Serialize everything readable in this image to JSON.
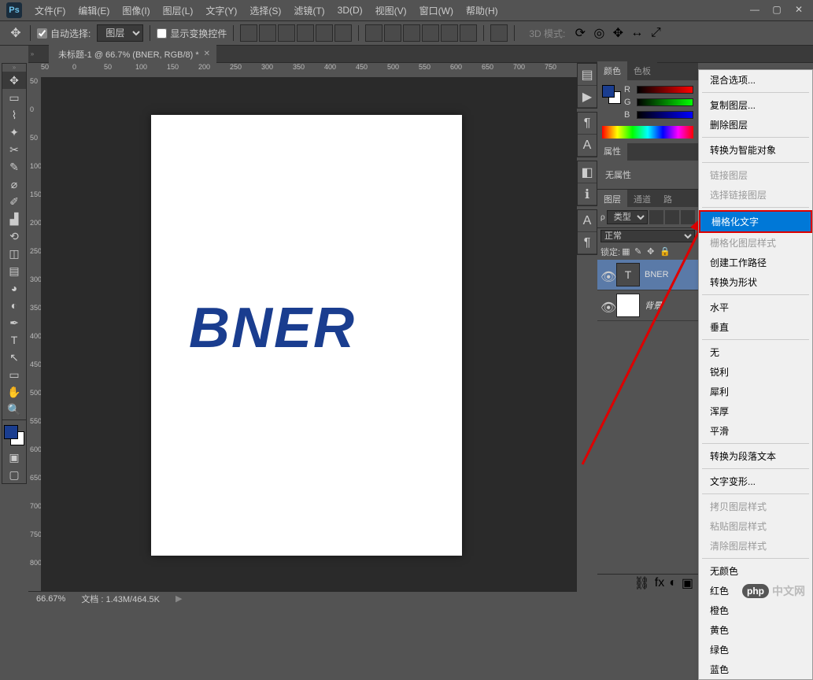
{
  "app": {
    "logo": "Ps"
  },
  "menu": [
    "文件(F)",
    "编辑(E)",
    "图像(I)",
    "图层(L)",
    "文字(Y)",
    "选择(S)",
    "滤镜(T)",
    "3D(D)",
    "视图(V)",
    "窗口(W)",
    "帮助(H)"
  ],
  "options": {
    "auto_select": "自动选择:",
    "layer_select": "图层",
    "show_transform": "显示变换控件",
    "mode_3d": "3D 模式:"
  },
  "tab": {
    "title": "未标题-1 @ 66.7% (BNER, RGB/8) *"
  },
  "ruler_h": [
    "50",
    "0",
    "50",
    "100",
    "150",
    "200",
    "250",
    "300",
    "350",
    "400",
    "450",
    "500",
    "550",
    "600",
    "650",
    "700",
    "750"
  ],
  "ruler_v": [
    "50",
    "0",
    "50",
    "100",
    "150",
    "200",
    "250",
    "300",
    "350",
    "400",
    "450",
    "500",
    "550",
    "600",
    "650",
    "700",
    "750",
    "800"
  ],
  "canvas": {
    "text": "BNER"
  },
  "panels": {
    "color_tab": "颜色",
    "swatches_tab": "色板",
    "r": "R",
    "g": "G",
    "b": "B",
    "props_tab": "属性",
    "no_props": "无属性",
    "layers_tab": "图层",
    "channels_tab": "通道",
    "paths_tab": "路",
    "kind": "类型",
    "blend": "正常",
    "lock_label": "锁定:",
    "layer_text_name": "BNER",
    "layer_bg_name": "背景",
    "thumb_t": "T"
  },
  "context_menu": {
    "items": [
      {
        "label": "混合选项...",
        "type": "item"
      },
      {
        "type": "sep"
      },
      {
        "label": "复制图层...",
        "type": "item"
      },
      {
        "label": "删除图层",
        "type": "item"
      },
      {
        "type": "sep"
      },
      {
        "label": "转换为智能对象",
        "type": "item"
      },
      {
        "type": "sep"
      },
      {
        "label": "链接图层",
        "type": "disabled"
      },
      {
        "label": "选择链接图层",
        "type": "disabled"
      },
      {
        "type": "sep"
      },
      {
        "label": "栅格化文字",
        "type": "highlighted"
      },
      {
        "label": "栅格化图层样式",
        "type": "disabled"
      },
      {
        "label": "创建工作路径",
        "type": "item"
      },
      {
        "label": "转换为形状",
        "type": "item"
      },
      {
        "type": "sep"
      },
      {
        "label": "水平",
        "type": "item"
      },
      {
        "label": "垂直",
        "type": "item"
      },
      {
        "type": "sep"
      },
      {
        "label": "无",
        "type": "item"
      },
      {
        "label": "锐利",
        "type": "item"
      },
      {
        "label": "犀利",
        "type": "item"
      },
      {
        "label": "浑厚",
        "type": "item"
      },
      {
        "label": "平滑",
        "type": "item"
      },
      {
        "type": "sep"
      },
      {
        "label": "转换为段落文本",
        "type": "item"
      },
      {
        "type": "sep"
      },
      {
        "label": "文字变形...",
        "type": "item"
      },
      {
        "type": "sep"
      },
      {
        "label": "拷贝图层样式",
        "type": "disabled"
      },
      {
        "label": "粘贴图层样式",
        "type": "disabled"
      },
      {
        "label": "清除图层样式",
        "type": "disabled"
      },
      {
        "type": "sep"
      },
      {
        "label": "无颜色",
        "type": "item"
      },
      {
        "label": "红色",
        "type": "item"
      },
      {
        "label": "橙色",
        "type": "item"
      },
      {
        "label": "黄色",
        "type": "item"
      },
      {
        "label": "绿色",
        "type": "item"
      },
      {
        "label": "蓝色",
        "type": "item"
      }
    ]
  },
  "status": {
    "zoom": "66.67%",
    "doc": "文档 : 1.43M/464.5K"
  },
  "watermark": {
    "badge": "php",
    "text": "中文网"
  }
}
